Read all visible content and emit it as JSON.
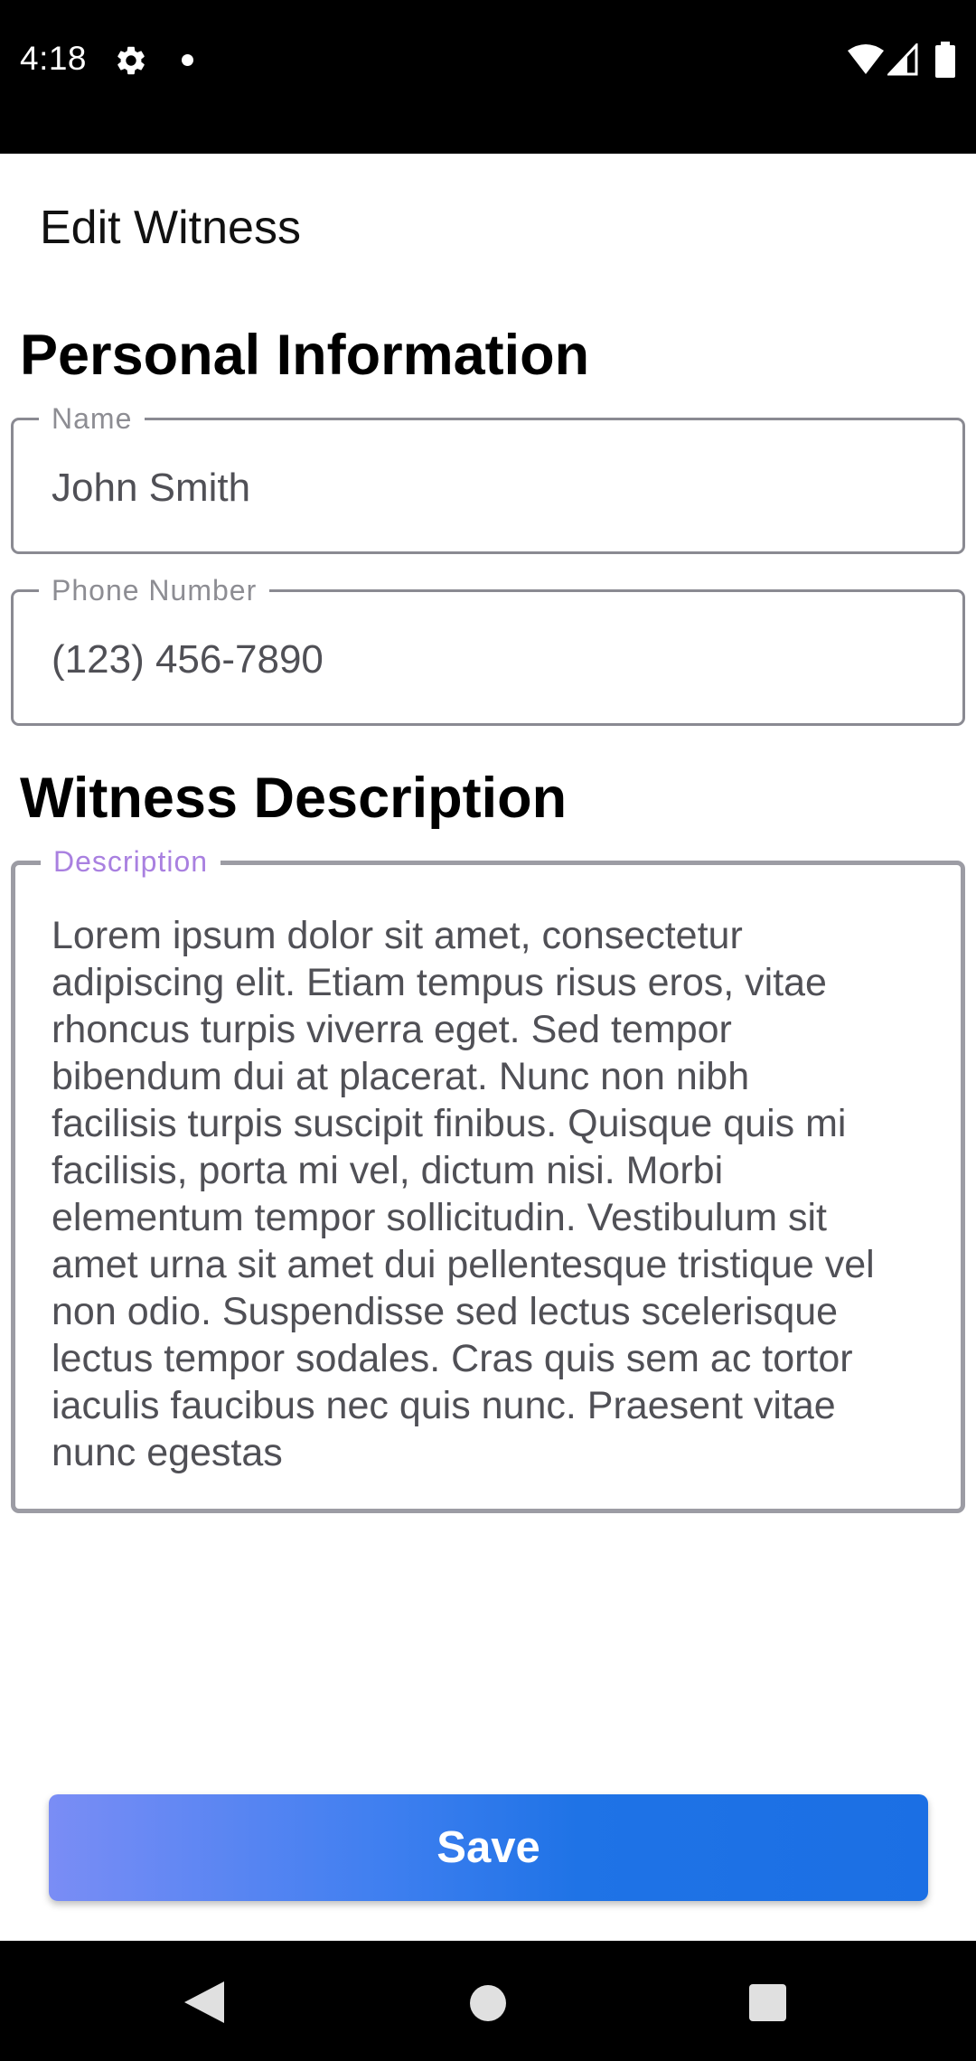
{
  "status_bar": {
    "time": "4:18",
    "icons": [
      "gear-icon",
      "notification-dot-icon",
      "wifi-icon",
      "cell-signal-icon",
      "battery-icon"
    ]
  },
  "app_bar": {
    "title": "Edit Witness"
  },
  "personal_section": {
    "heading": "Personal Information",
    "name_field": {
      "label": "Name",
      "value": "John Smith"
    },
    "phone_field": {
      "label": "Phone Number",
      "value": "(123) 456-7890"
    }
  },
  "witness_section": {
    "heading": "Witness Description",
    "description_field": {
      "label": "Description",
      "value": "Lorem ipsum dolor sit amet, consectetur\nadipiscing elit. Etiam tempus risus eros, vitae\nrhoncus turpis viverra eget. Sed tempor\nbibendum dui at placerat. Nunc non nibh\nfacilisis turpis suscipit finibus. Quisque quis mi\nfacilisis, porta mi vel, dictum nisi. Morbi\nelementum tempor sollicitudin. Vestibulum sit\namet urna sit amet dui pellentesque tristique vel\nnon odio. Suspendisse sed lectus scelerisque\nlectus tempor sodales. Cras quis sem ac tortor\niaculis faucibus nec quis nunc. Praesent vitae\nnunc egestas"
    }
  },
  "save_button": {
    "label": "Save"
  },
  "colors": {
    "accent": "#1b6fe4",
    "gradient_start": "#7a8df5",
    "focused_label": "#a980e0",
    "field_border": "#8a8a92"
  },
  "nav_bar": {
    "icons": [
      "back-icon",
      "home-icon",
      "recents-icon"
    ]
  }
}
